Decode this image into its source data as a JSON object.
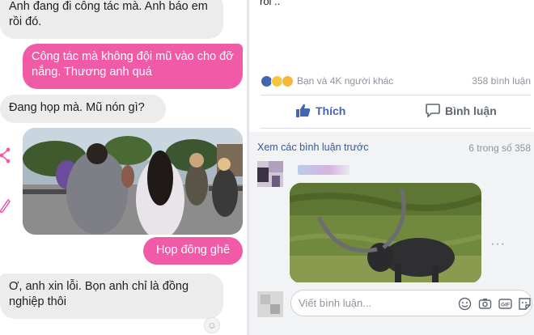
{
  "messenger": {
    "messages": [
      {
        "from": "contact",
        "text": "Anh đang đi công tác mà. Anh báo em rồi đó."
      },
      {
        "from": "me",
        "text": "Công tác mà không đội mũ vào cho đỡ nắng. Thương anh quá"
      },
      {
        "from": "contact",
        "text": "Đang họp mà. Mũ nón gì?"
      },
      {
        "from": "me",
        "type": "photo"
      },
      {
        "from": "me",
        "text": "Họp đông ghê"
      },
      {
        "from": "contact",
        "text": "Ơ, anh xin lỗi. Bọn anh chỉ là đồng nghiệp thôi"
      }
    ],
    "colors": {
      "outgoing": "#f05aa6",
      "incoming": "#ececec"
    }
  },
  "facebook": {
    "post_text_tail": "roi ..",
    "reaction_summary": "Bạn và 4K người khác",
    "comment_count": "358 bình luận",
    "like_label": "Thích",
    "comment_label": "Bình luận",
    "view_previous": "Xem các bình luận trước",
    "shown_count": "6 trong số 358",
    "composer_placeholder": "Viết bình luận...",
    "colors": {
      "link": "#385898",
      "like": "#4267b2"
    }
  }
}
